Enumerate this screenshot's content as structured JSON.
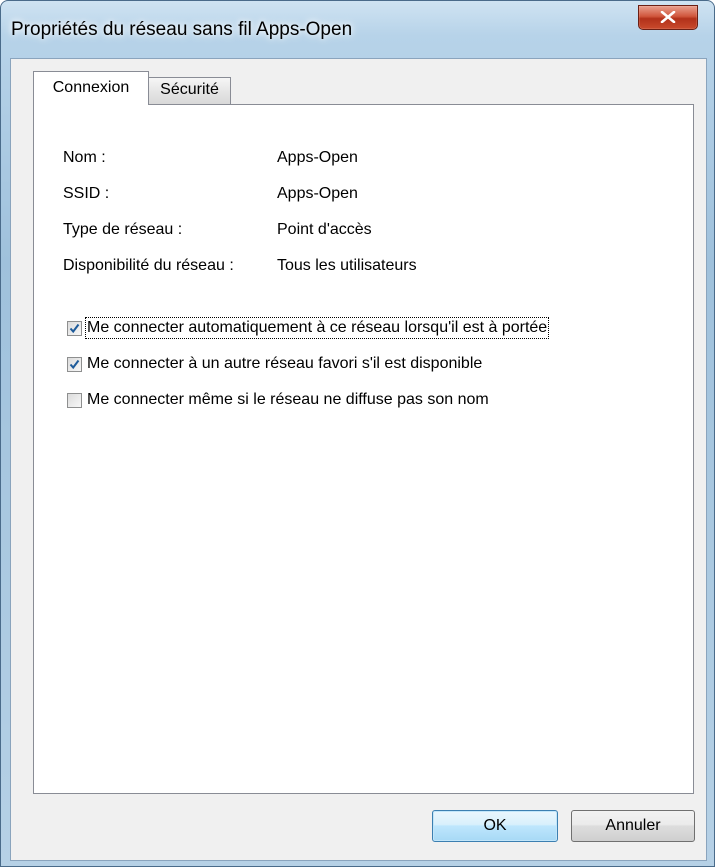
{
  "window": {
    "title": "Propriétés du réseau sans fil Apps-Open"
  },
  "tabs": [
    {
      "label": "Connexion",
      "active": true
    },
    {
      "label": "Sécurité",
      "active": false
    }
  ],
  "info": [
    {
      "label": "Nom :",
      "value": "Apps-Open"
    },
    {
      "label": "SSID :",
      "value": "Apps-Open"
    },
    {
      "label": "Type de réseau :",
      "value": "Point d'accès"
    },
    {
      "label": "Disponibilité du réseau :",
      "value": "Tous les utilisateurs"
    }
  ],
  "options": [
    {
      "label": "Me connecter automatiquement à ce réseau lorsqu'il est à portée",
      "checked": true
    },
    {
      "label": "Me connecter à un autre réseau favori s'il est disponible",
      "checked": true
    },
    {
      "label": "Me connecter même si le réseau ne diffuse pas son nom",
      "checked": false
    }
  ],
  "buttons": {
    "ok": "OK",
    "cancel": "Annuler"
  },
  "icons": {
    "close": "close-icon",
    "check": "checkmark-icon"
  },
  "colors": {
    "title_glass": "#a9c8e0",
    "close_red": "#c94a2c",
    "ok_blue": "#bee6fd"
  }
}
